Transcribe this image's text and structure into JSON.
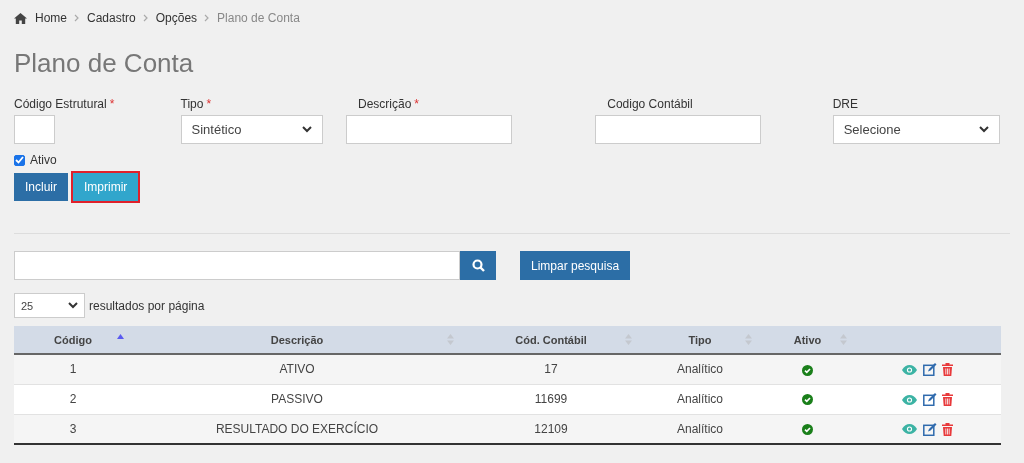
{
  "breadcrumb": [
    {
      "label": "Home",
      "current": false
    },
    {
      "label": "Cadastro",
      "current": false
    },
    {
      "label": "Opções",
      "current": false
    },
    {
      "label": "Plano de Conta",
      "current": true
    }
  ],
  "page_title": "Plano de Conta",
  "form": {
    "fields": [
      {
        "label": "Código Estrutural",
        "required_mark": "*",
        "kind": "input"
      },
      {
        "label": "Tipo",
        "required_mark": "*",
        "kind": "select",
        "value": "Sintético"
      },
      {
        "label": "Descrição",
        "required_mark": "*",
        "kind": "input"
      },
      {
        "label": "Codigo Contábil",
        "kind": "input"
      },
      {
        "label": "DRE",
        "kind": "select",
        "value": "Selecione"
      }
    ],
    "ativo": {
      "label": "Ativo",
      "checked": true
    },
    "buttons": [
      {
        "label": "Incluir",
        "kind": "primary",
        "highlighted": false
      },
      {
        "label": "Imprimir",
        "kind": "info",
        "highlighted": true
      }
    ]
  },
  "search": {
    "clear_button": "Limpar pesquisa"
  },
  "page_size": {
    "value": "25",
    "label": "resultados por página"
  },
  "table": {
    "columns": [
      {
        "label": "Código",
        "sorted": true
      },
      {
        "label": "Descrição",
        "sorted": false
      },
      {
        "label": "Cód. Contábil",
        "sorted": false
      },
      {
        "label": "Tipo",
        "sorted": false
      },
      {
        "label": "Ativo",
        "sorted": false
      }
    ],
    "rows": [
      {
        "codigo": "1",
        "descricao": "ATIVO",
        "cod_contabil": "17",
        "tipo": "Analítico",
        "ativo": true
      },
      {
        "codigo": "2",
        "descricao": "PASSIVO",
        "cod_contabil": "11699",
        "tipo": "Analítico",
        "ativo": true
      },
      {
        "codigo": "3",
        "descricao": "RESULTADO DO EXERCÍCIO",
        "cod_contabil": "12109",
        "tipo": "Analítico",
        "ativo": true
      }
    ]
  }
}
